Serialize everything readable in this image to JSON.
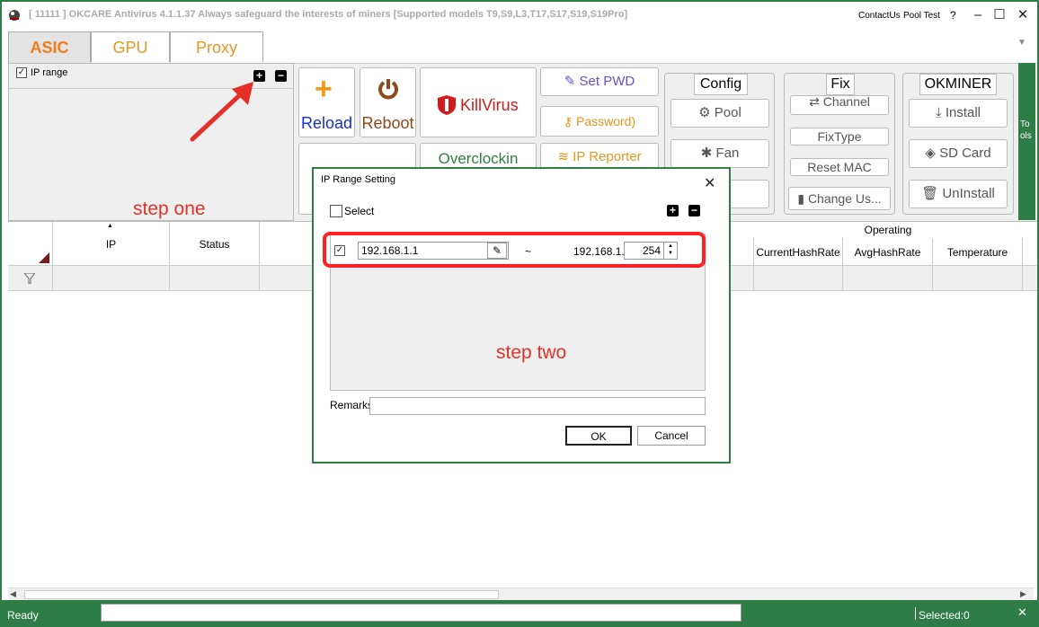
{
  "window": {
    "title": "[ 11111 ]  OKCARE Antivirus 4.1.1.37  Always safeguard the interests of miners [Supported models T9,S9,L3,T17,S17,S19,S19Pro]",
    "links": [
      "ContactUs",
      "Pool Test",
      "?"
    ],
    "controls": [
      "–",
      "☐",
      "✕"
    ]
  },
  "tabs": [
    {
      "label": "ASIC",
      "active": true
    },
    {
      "label": "GPU",
      "active": false
    },
    {
      "label": "Proxy",
      "active": false
    }
  ],
  "ip_panel": {
    "checkbox_label": "IP range",
    "checked": true,
    "add": "+",
    "remove": "−"
  },
  "annotations": {
    "step_one": "step one",
    "step_two": "step two"
  },
  "toolbar": {
    "reload": "Reload",
    "reboot": "Reboot",
    "killvirus": "KillVirus",
    "set_pwd": "Set PWD",
    "password": "Password)",
    "overclocking": "Overclockin",
    "ip_reporter": "IP Reporter",
    "config": {
      "title": "Config",
      "items": [
        "Pool",
        "Fan",
        ""
      ]
    },
    "fix": {
      "title": "Fix",
      "items": [
        "Channel",
        "FixType",
        "Reset MAC",
        "Change Us..."
      ]
    },
    "okminer": {
      "title": "OKMINER",
      "items": [
        "Install",
        "SD Card",
        "UnInstall"
      ]
    },
    "tools": "Tools"
  },
  "grid": {
    "columns": [
      "IP",
      "Status"
    ],
    "operating_group": "Operating",
    "operating_columns": [
      "CurrentHashRate",
      "AvgHashRate",
      "Temperature"
    ]
  },
  "status": {
    "ready": "Ready",
    "selected": "Selected:0"
  },
  "dialog": {
    "title": "IP Range Setting",
    "close": "✕",
    "select_label": "Select",
    "add": "+",
    "remove": "−",
    "row": {
      "checked": true,
      "start_ip": "192.168.1.1",
      "tilde": "~",
      "prefix": "192.168.1.",
      "end_value": "254"
    },
    "remarks_label": "Remarks",
    "remarks_value": "",
    "ok": "OK",
    "cancel": "Cancel"
  },
  "colors": {
    "accent_green": "#2e7d46",
    "orange": "#e8961e",
    "annotation_red": "#e53028",
    "blue_text": "#1730c9",
    "brown_text": "#8a4a1b",
    "red_text": "#d41b1b",
    "purple_text": "#6a4fc6"
  }
}
